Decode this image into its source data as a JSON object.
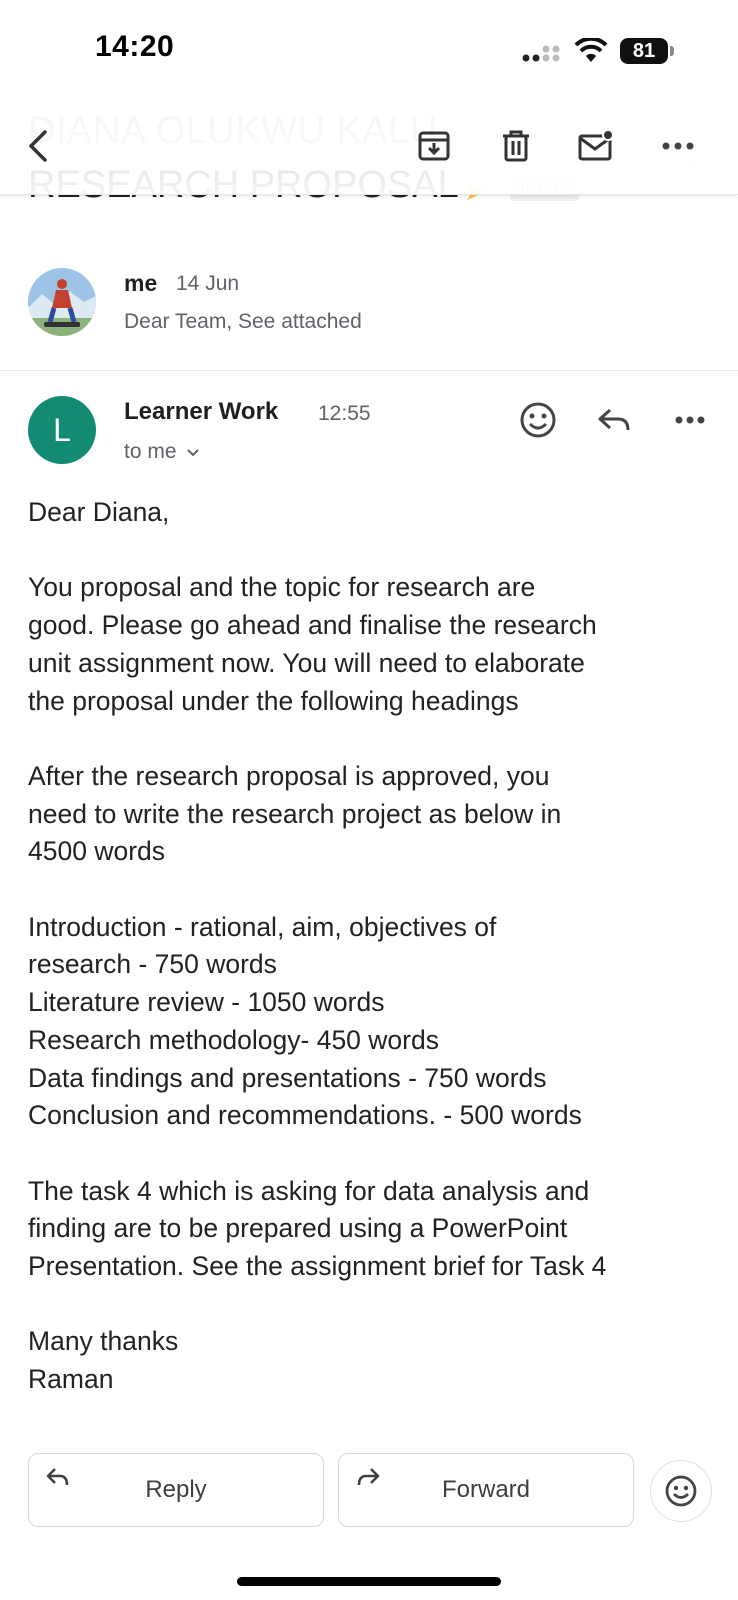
{
  "status_bar": {
    "time": "14:20",
    "battery": "81"
  },
  "subject": {
    "line1": "DIANA OLUKWU KALU",
    "line2": "RESEARCH PROPOSAL",
    "label_chip": "Inbox"
  },
  "toolbar": {
    "icons": [
      "back-icon",
      "archive-icon",
      "delete-icon",
      "mark-unread-icon",
      "more-icon"
    ]
  },
  "collapsed_message": {
    "sender": "me",
    "date": "14 Jun",
    "snippet": "Dear Team, See attached"
  },
  "message": {
    "avatar_letter": "L",
    "avatar_color": "#138a72",
    "sender": "Learner Work",
    "time": "12:55",
    "recipient": "to me",
    "body": [
      "Dear Diana,",
      "",
      "You proposal and the topic for research are",
      "good. Please go ahead and finalise the research",
      "unit assignment now. You will need to elaborate",
      "the proposal  under the following headings",
      "",
      "After the research proposal is approved, you",
      "need to write the research project as below in",
      "4500 words",
      "",
      "Introduction - rational, aim, objectives of",
      "research  - 750 words",
      "Literature review  - 1050 words",
      "Research methodology- 450 words",
      "Data findings and presentations - 750 words",
      "Conclusion and recommendations. - 500 words",
      "",
      "The task 4 which is asking for data analysis and",
      "finding are to be prepared using a PowerPoint",
      "Presentation. See the assignment brief for Task 4",
      "",
      "Many thanks",
      "Raman"
    ]
  },
  "actions": {
    "reply": "Reply",
    "forward": "Forward"
  }
}
